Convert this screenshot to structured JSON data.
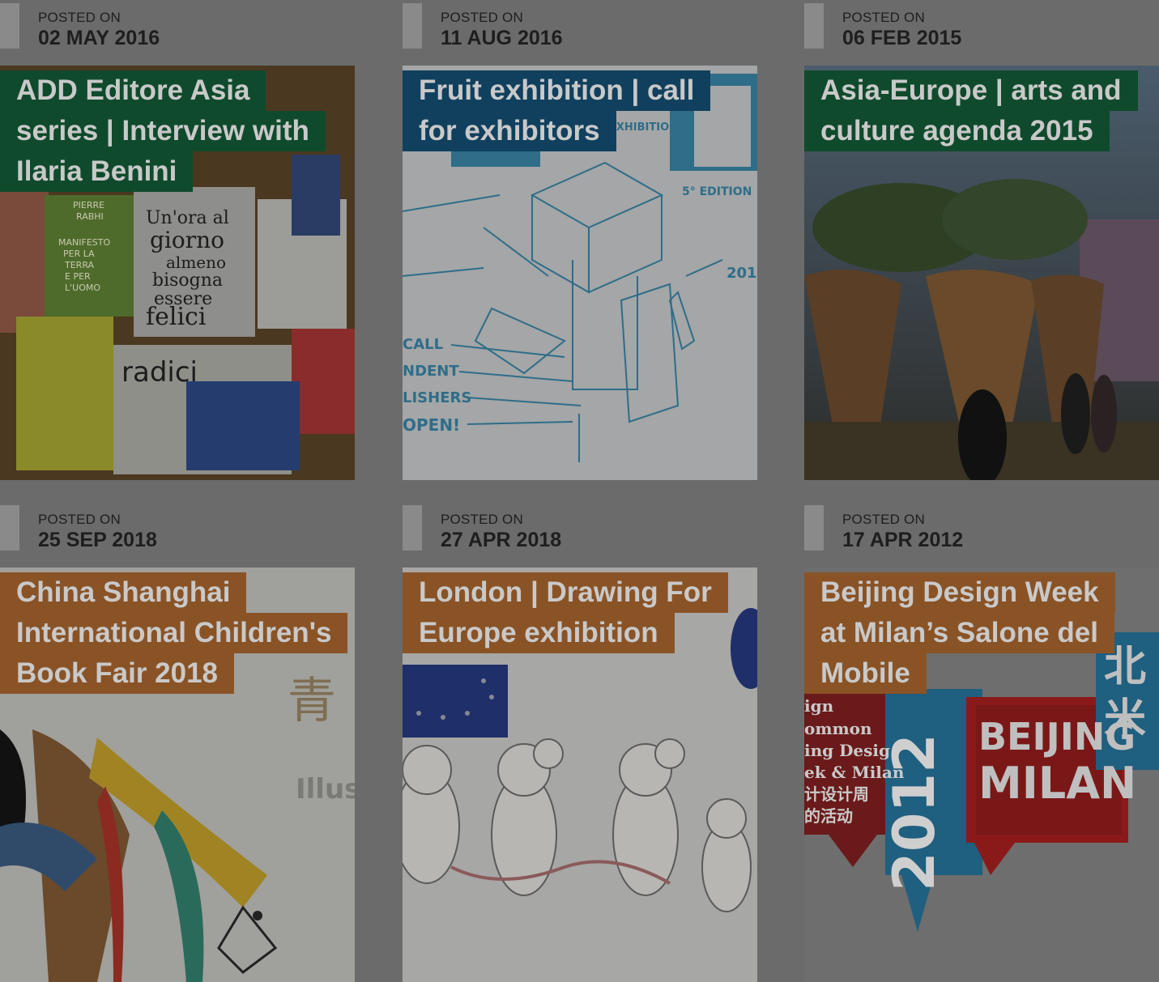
{
  "posted_label": "POSTED ON",
  "posts": [
    {
      "date": "02 MAY 2016",
      "title_lines": [
        "ADD Editore Asia",
        "series | Interview with",
        "Ilaria Benini"
      ],
      "title_color": "#0f4a2c",
      "thumb_color": "#4a3820",
      "image_text": [
        "Un'ora al",
        "giorno",
        "almeno",
        "bisogna",
        "essere",
        "felici",
        "radici",
        "MANIFESTO",
        "PER LA",
        "TERRA",
        "E PER",
        "L'UOMO",
        "PIERRE",
        "RABHI"
      ]
    },
    {
      "date": "11 AUG 2016",
      "title_lines": [
        "Fruit exhibition | call",
        "for exhibitors"
      ],
      "title_color": "#10405e",
      "thumb_color": "#a4a6a7",
      "image_text": [
        "EXHIBITION",
        "5° EDITION",
        "201",
        "CALL",
        "NDENT",
        "LISHERS",
        "OPEN!"
      ]
    },
    {
      "date": "06 FEB 2015",
      "title_lines": [
        "Asia-Europe | arts and",
        "culture agenda 2015"
      ],
      "title_color": "#0f4a2c",
      "thumb_color": "#3a3a34",
      "image_text": []
    },
    {
      "date": "25 SEP 2018",
      "title_lines": [
        "China Shanghai",
        "International Children's",
        "Book Fair 2018"
      ],
      "title_color": "#8a5326",
      "thumb_color": "#a0a09c",
      "image_text": [
        "青",
        "Illust"
      ]
    },
    {
      "date": "27 APR 2018",
      "title_lines": [
        "London | Drawing For",
        "Europe exhibition"
      ],
      "title_color": "#8a5326",
      "thumb_color": "#a7a7a5",
      "image_text": []
    },
    {
      "date": "17 APR 2012",
      "title_lines": [
        "Beijing Design Week",
        "at Milan’s Salone del",
        "Mobile"
      ],
      "title_color": "#8a5326",
      "thumb_color": "#9d9d9d",
      "image_text": [
        "BEIJING",
        "MILAN",
        "北",
        "米",
        "ign",
        "ommon",
        "ing Desig",
        "ek & Milan",
        "计设计周",
        "的活动",
        "2012"
      ]
    }
  ]
}
